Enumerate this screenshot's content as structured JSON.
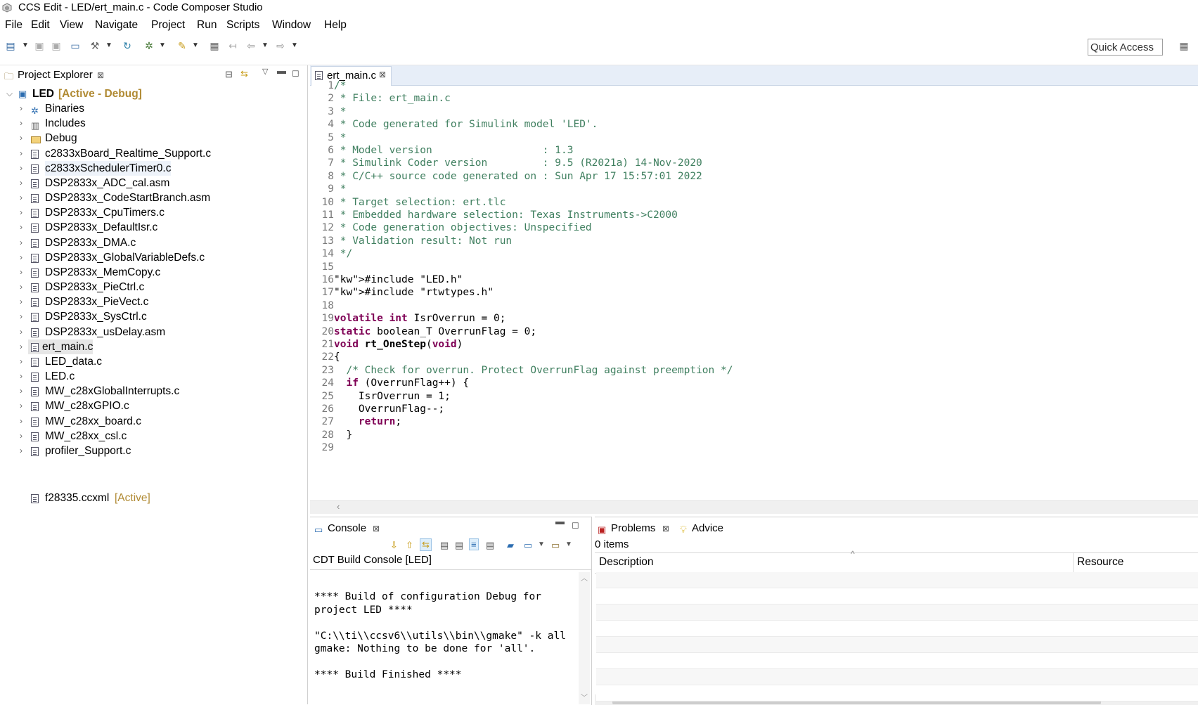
{
  "window": {
    "title": "CCS Edit - LED/ert_main.c - Code Composer Studio"
  },
  "menu": [
    "File",
    "Edit",
    "View",
    "Navigate",
    "Project",
    "Run",
    "Scripts",
    "Window",
    "Help"
  ],
  "toolbar": {
    "quick_access": "Quick Access"
  },
  "explorer": {
    "tab_label": "Project Explorer",
    "project": {
      "name": "LED",
      "status": "[Active - Debug]"
    },
    "items": [
      {
        "label": "Binaries",
        "icon": "binaries-icon"
      },
      {
        "label": "Includes",
        "icon": "includes-icon"
      },
      {
        "label": "Debug",
        "icon": "folder-icon"
      },
      {
        "label": "c2833xBoard_Realtime_Support.c",
        "icon": "c-file-icon"
      },
      {
        "label": "c2833xSchedulerTimer0.c",
        "icon": "c-file-icon"
      },
      {
        "label": "DSP2833x_ADC_cal.asm",
        "icon": "asm-file-icon"
      },
      {
        "label": "DSP2833x_CodeStartBranch.asm",
        "icon": "asm-file-icon"
      },
      {
        "label": "DSP2833x_CpuTimers.c",
        "icon": "c-file-icon"
      },
      {
        "label": "DSP2833x_DefaultIsr.c",
        "icon": "c-file-icon"
      },
      {
        "label": "DSP2833x_DMA.c",
        "icon": "c-file-icon"
      },
      {
        "label": "DSP2833x_GlobalVariableDefs.c",
        "icon": "c-file-icon"
      },
      {
        "label": "DSP2833x_MemCopy.c",
        "icon": "c-file-icon"
      },
      {
        "label": "DSP2833x_PieCtrl.c",
        "icon": "c-file-icon"
      },
      {
        "label": "DSP2833x_PieVect.c",
        "icon": "c-file-icon"
      },
      {
        "label": "DSP2833x_SysCtrl.c",
        "icon": "c-file-icon"
      },
      {
        "label": "DSP2833x_usDelay.asm",
        "icon": "asm-file-icon"
      },
      {
        "label": "ert_main.c",
        "icon": "c-file-icon"
      },
      {
        "label": "LED_data.c",
        "icon": "c-file-icon"
      },
      {
        "label": "LED.c",
        "icon": "c-file-icon"
      },
      {
        "label": "MW_c28xGlobalInterrupts.c",
        "icon": "c-file-icon"
      },
      {
        "label": "MW_c28xGPIO.c",
        "icon": "c-file-icon"
      },
      {
        "label": "MW_c28xx_board.c",
        "icon": "c-file-icon"
      },
      {
        "label": "MW_c28xx_csl.c",
        "icon": "c-file-icon"
      },
      {
        "label": "profiler_Support.c",
        "icon": "c-file-icon"
      }
    ],
    "config_file": {
      "label": "f28335.ccxml",
      "status": "[Active]"
    }
  },
  "editor": {
    "tab_label": "ert_main.c",
    "lines": [
      "/*",
      " * File: ert_main.c",
      " *",
      " * Code generated for Simulink model 'LED'.",
      " *",
      " * Model version                  : 1.3",
      " * Simulink Coder version         : 9.5 (R2021a) 14-Nov-2020",
      " * C/C++ source code generated on : Sun Apr 17 15:57:01 2022",
      " *",
      " * Target selection: ert.tlc",
      " * Embedded hardware selection: Texas Instruments->C2000",
      " * Code generation objectives: Unspecified",
      " * Validation result: Not run",
      " */",
      "",
      "#include \"LED.h\"",
      "#include \"rtwtypes.h\"",
      "",
      "volatile int IsrOverrun = 0;",
      "static boolean_T OverrunFlag = 0;",
      "void rt_OneStep(void)",
      "{",
      "  /* Check for overrun. Protect OverrunFlag against preemption */",
      "  if (OverrunFlag++) {",
      "    IsrOverrun = 1;",
      "    OverrunFlag--;",
      "    return;",
      "  }",
      ""
    ]
  },
  "console": {
    "tab_label": "Console",
    "title": "CDT Build Console [LED]",
    "lines": [
      "",
      "**** Build of configuration Debug for",
      "project LED ****",
      "",
      "\"C:\\\\ti\\\\ccsv6\\\\utils\\\\bin\\\\gmake\" -k all",
      "gmake: Nothing to be done for 'all'.",
      "",
      "**** Build Finished ****"
    ]
  },
  "problems": {
    "tab_label": "Problems",
    "advice_label": "Advice",
    "count": "0 items",
    "columns": [
      "Description",
      "Resource"
    ]
  },
  "colors": {
    "comment": "#3f7f5f",
    "keyword": "#7f0055",
    "string": "#2a00ff",
    "active": "#b08a33"
  }
}
